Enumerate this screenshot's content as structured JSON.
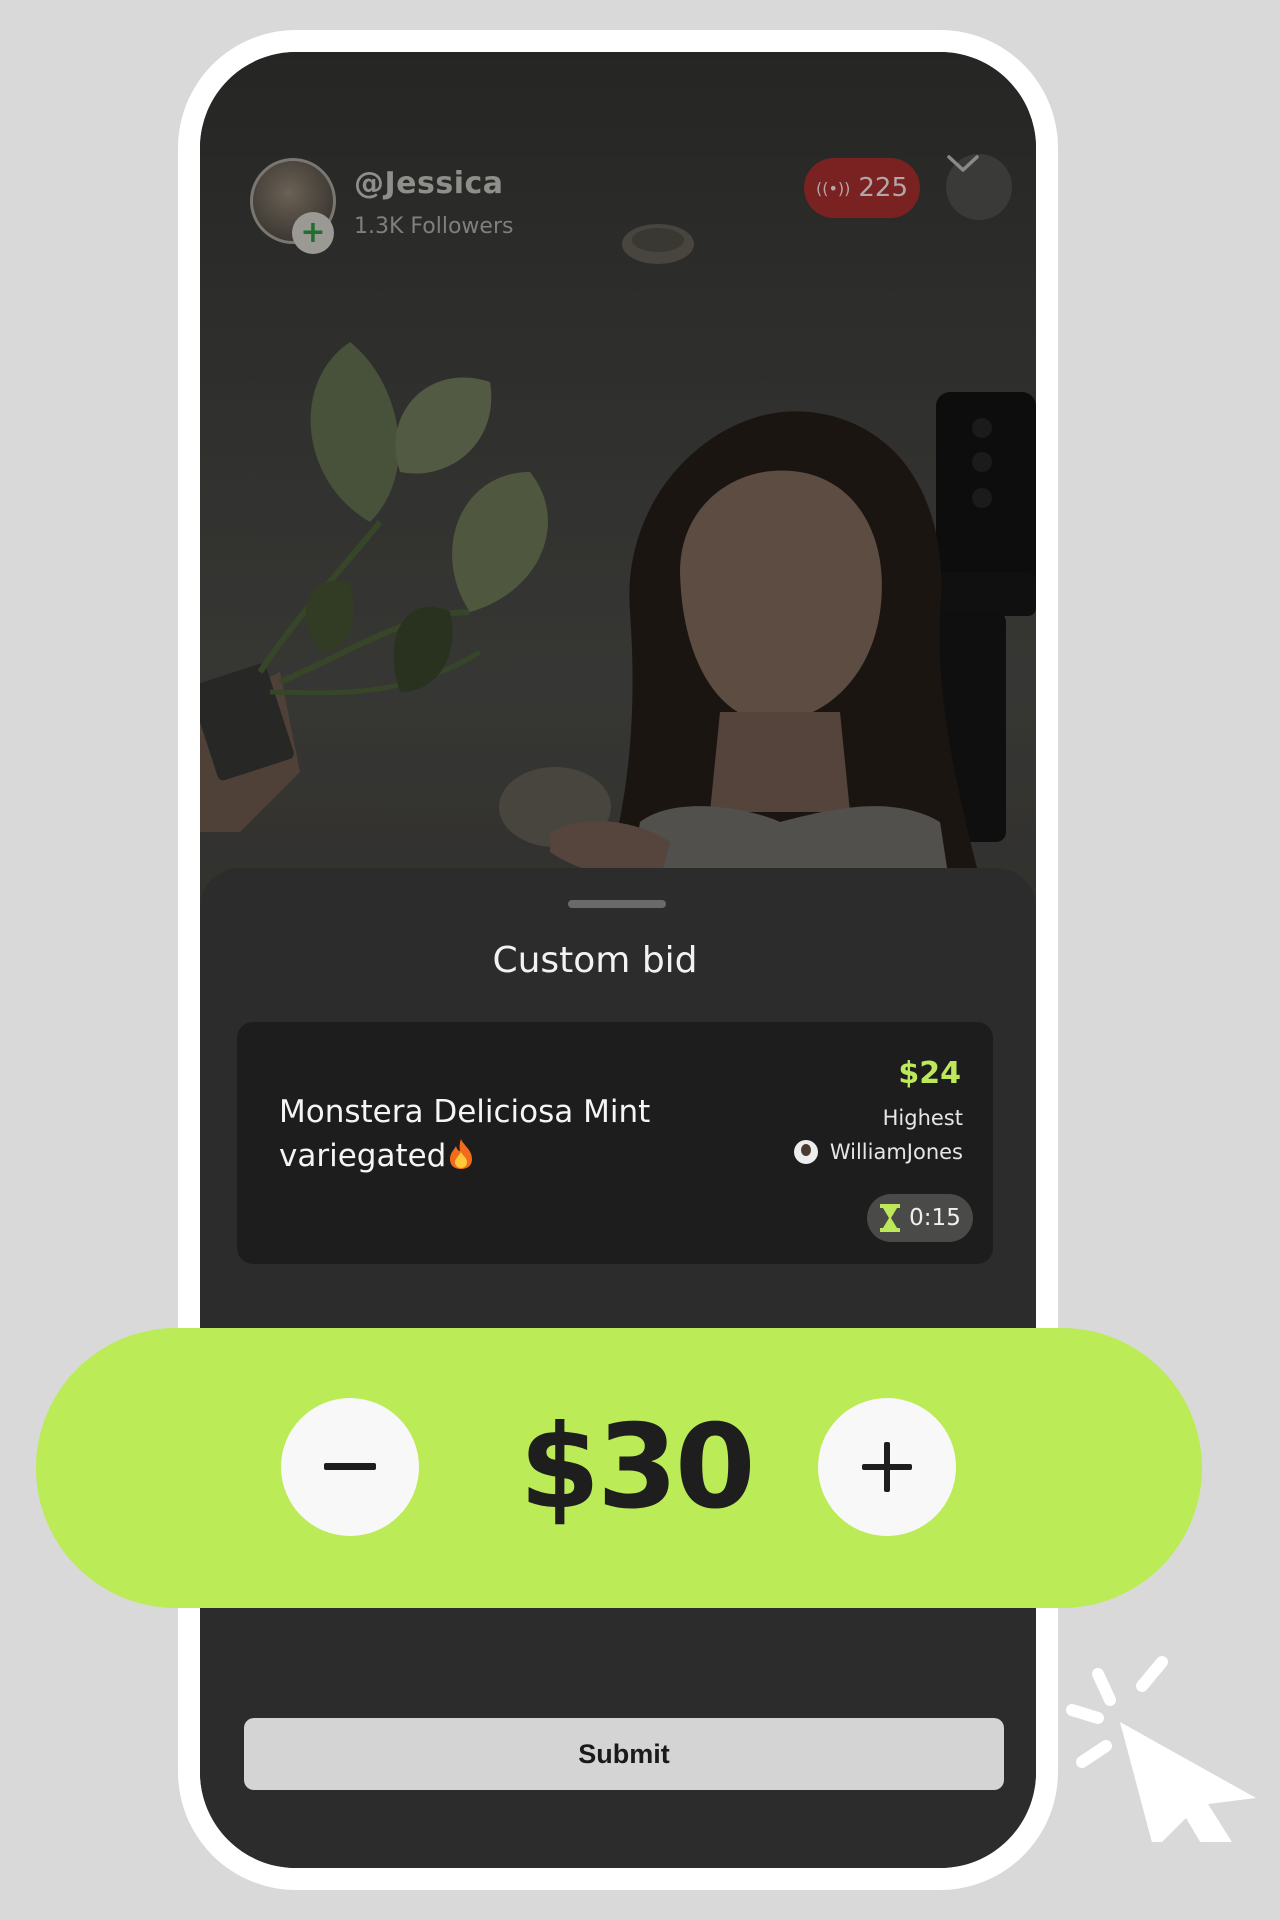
{
  "stream": {
    "host_handle": "@Jessica",
    "host_followers": "1.3K Followers",
    "viewer_count": "225",
    "live_icon": "broadcast-icon",
    "collapse_icon": "chevron-down-icon"
  },
  "sheet": {
    "title": "Custom bid",
    "product": {
      "name": "Monstera Deliciosa Mint variegated",
      "name_emoji": "fire-icon",
      "highest_amount": "$24",
      "highest_label": "Highest",
      "highest_bidder": "WilliamJones",
      "timer": "0:15",
      "timer_icon": "hourglass-icon"
    },
    "submit_label": "Submit"
  },
  "bid_control": {
    "amount": "$30",
    "decrement_icon": "minus-icon",
    "increment_icon": "plus-icon"
  },
  "colors": {
    "accent_green": "#bbeb57",
    "highest_green": "#bde85a",
    "sheet_background": "#2c2c2c",
    "card_background": "#1d1d1d",
    "live_red": "#7a2222"
  }
}
